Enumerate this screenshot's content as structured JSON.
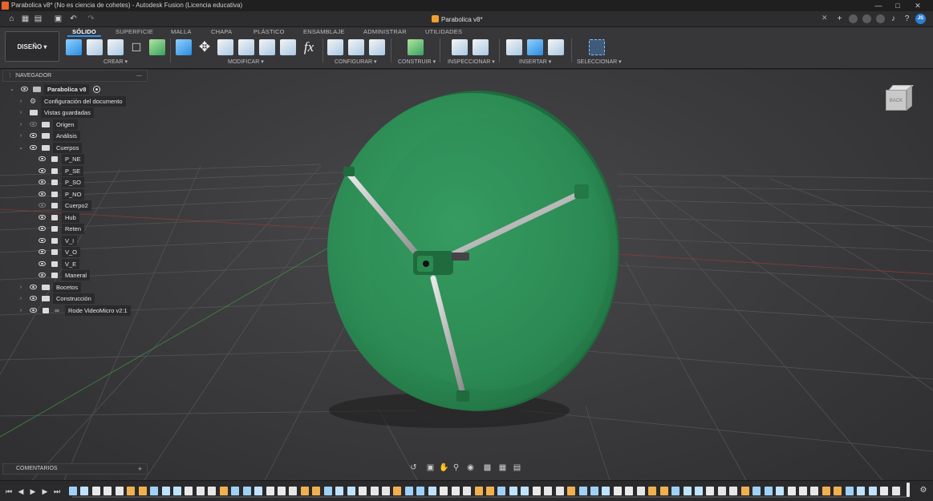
{
  "window": {
    "title": "Parabolica v8* (No es ciencia de cohetes) - Autodesk Fusion (Licencia educativa)",
    "controls": [
      "minimize",
      "maximize",
      "close"
    ]
  },
  "document_tab": {
    "label": "Parabolica v8*"
  },
  "user": {
    "initials": "JS"
  },
  "ribbon": {
    "workspace": "DISEÑO",
    "tabs": [
      "SÓLIDO",
      "SUPERFICIE",
      "MALLA",
      "CHAPA",
      "PLÁSTICO",
      "ENSAMBLAJE",
      "ADMINISTRAR",
      "UTILIDADES"
    ],
    "active_tab": "SÓLIDO",
    "groups": [
      "CREAR",
      "MODIFICAR",
      "CONFIGURAR",
      "CONSTRUIR",
      "INSPECCIONAR",
      "INSERTAR",
      "SELECCIONAR"
    ]
  },
  "browser": {
    "header": "NAVEGADOR",
    "root": "Parabolica v8",
    "items": [
      {
        "label": "Configuración del documento",
        "icon": "gear-icon",
        "expandable": true
      },
      {
        "label": "Vistas guardadas",
        "icon": "folder-icon",
        "expandable": true
      },
      {
        "label": "Origen",
        "icon": "folder-icon",
        "expandable": true,
        "visible": false
      },
      {
        "label": "Análisis",
        "icon": "folder-icon",
        "expandable": true,
        "visible": true
      },
      {
        "label": "Cuerpos",
        "icon": "folder-icon",
        "expandable": true,
        "expanded": true,
        "visible": true
      }
    ],
    "bodies": [
      {
        "label": "P_NE",
        "visible": true
      },
      {
        "label": "P_SE",
        "visible": true
      },
      {
        "label": "P_SO",
        "visible": true
      },
      {
        "label": "P_NO",
        "visible": true
      },
      {
        "label": "Cuerpo2",
        "visible": false
      },
      {
        "label": "Hub",
        "visible": true
      },
      {
        "label": "Reten",
        "visible": true
      },
      {
        "label": "V_I",
        "visible": true
      },
      {
        "label": "V_O",
        "visible": true
      },
      {
        "label": "V_E",
        "visible": true
      },
      {
        "label": "Maneral",
        "visible": true
      }
    ],
    "after": [
      {
        "label": "Bocetos",
        "icon": "folder-icon"
      },
      {
        "label": "Construcción",
        "icon": "folder-icon"
      },
      {
        "label": "Rode VideoMicro v2:1",
        "icon": "link-icon"
      }
    ]
  },
  "viewcube": {
    "face": "BACK"
  },
  "comments": {
    "header": "COMENTARIOS"
  },
  "colors": {
    "dish": "#2e8a55",
    "dish_dark": "#1f6b3e",
    "accent": "#2f8ff0",
    "grid": "#5a5a5c"
  },
  "timeline": {
    "feature_count": 72
  }
}
